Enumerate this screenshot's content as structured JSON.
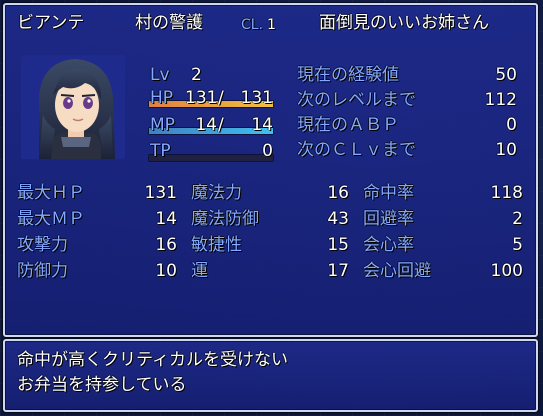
{
  "actor": {
    "name": "ビアンテ",
    "class": "村の警護",
    "cl_label": "CL.",
    "cl_value": "1",
    "nickname": "面倒見のいいお姉さん",
    "level_label": "Lv",
    "level": "2",
    "hp_label": "HP",
    "hp": "131",
    "hp_max": "131",
    "mp_label": "MP",
    "mp": "14",
    "mp_max": "14",
    "tp_label": "TP",
    "tp": "0",
    "hp_ratio": 1.0,
    "mp_ratio": 1.0,
    "tp_ratio": 0.0
  },
  "exp": {
    "current_label": "現在の経験値",
    "current": "50",
    "next_label": "次のレベルまで",
    "next": "112",
    "abp_label": "現在のＡＢＰ",
    "abp": "0",
    "next_cl_label": "次のＣＬｖまで",
    "next_cl": "10"
  },
  "params": {
    "col1": [
      {
        "label": "最大ＨＰ",
        "value": "131"
      },
      {
        "label": "最大ＭＰ",
        "value": "14"
      },
      {
        "label": "攻撃力",
        "value": "16"
      },
      {
        "label": "防御力",
        "value": "10"
      }
    ],
    "col2": [
      {
        "label": "魔法力",
        "value": "16"
      },
      {
        "label": "魔法防御",
        "value": "43"
      },
      {
        "label": "敏捷性",
        "value": "15"
      },
      {
        "label": "運",
        "value": "17"
      }
    ],
    "col3": [
      {
        "label": "命中率",
        "value": "118"
      },
      {
        "label": "回避率",
        "value": "2"
      },
      {
        "label": "会心率",
        "value": "5"
      },
      {
        "label": "会心回避",
        "value": "100"
      }
    ]
  },
  "profile": {
    "line1": "命中が高くクリティカルを受けない",
    "line2": "お弁当を持参している"
  },
  "colors": {
    "window": "#1e2a8c",
    "system_text": "#84aaff",
    "hp_gauge": "#f0a040",
    "mp_gauge": "#40a0f0"
  }
}
